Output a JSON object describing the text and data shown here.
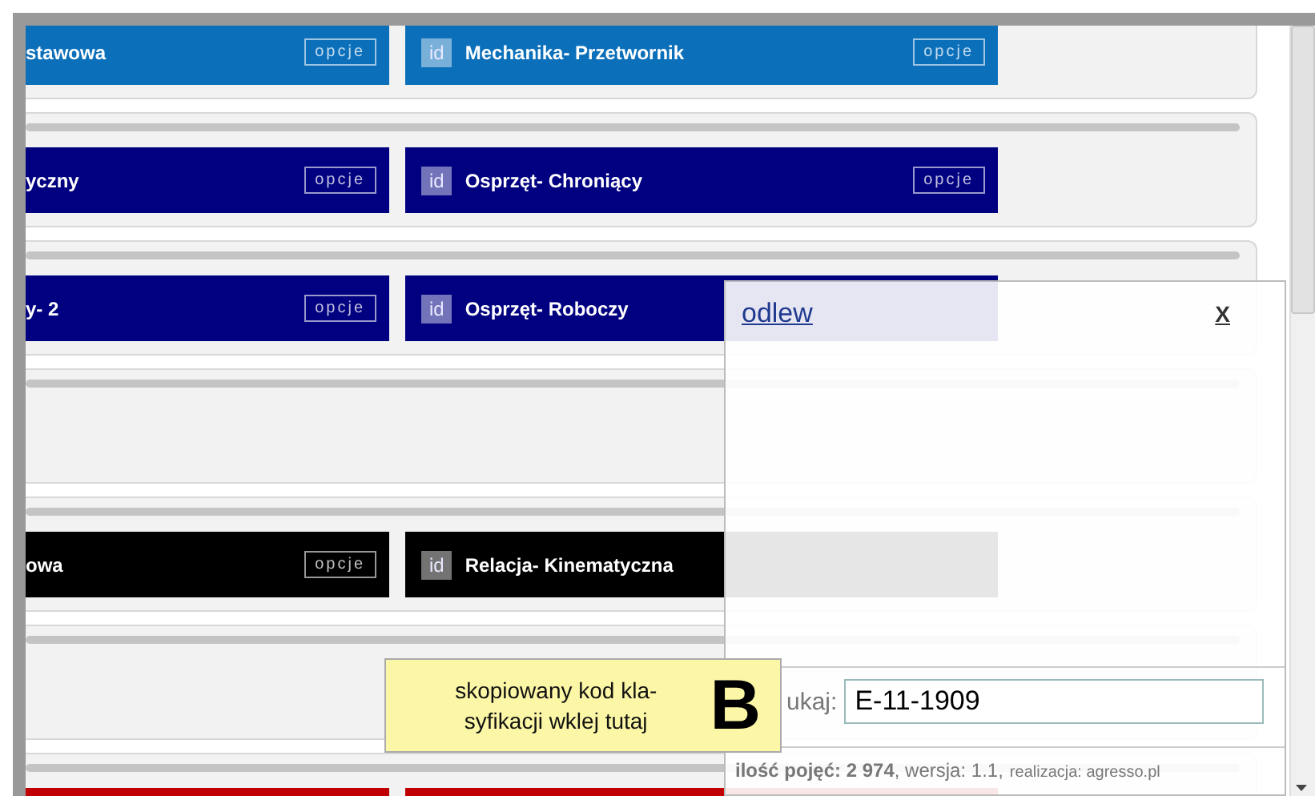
{
  "cards": [
    {
      "kind": "tiles",
      "color": "#0b6fba",
      "tiles": [
        {
          "label": "stawowa",
          "button": "opcje"
        },
        {
          "id_tag": "id",
          "label": "Mechanika- Przetwornik",
          "button": "opcje"
        }
      ]
    },
    {
      "kind": "tiles",
      "color": "#000080",
      "tiles": [
        {
          "label": "yczny",
          "button": "opcje"
        },
        {
          "id_tag": "id",
          "label": "Osprzęt- Chroniący",
          "button": "opcje"
        }
      ]
    },
    {
      "kind": "tiles",
      "color": "#000080",
      "tiles": [
        {
          "label": "y- 2",
          "button": "opcje"
        },
        {
          "id_tag": "id",
          "label": "Osprzęt- Roboczy"
        }
      ]
    },
    {
      "kind": "empty"
    },
    {
      "kind": "tiles",
      "color": "#000000",
      "tiles": [
        {
          "label": "owa",
          "button": "opcje"
        },
        {
          "id_tag": "id",
          "label": "Relacja- Kinematyczna"
        }
      ]
    },
    {
      "kind": "empty"
    },
    {
      "kind": "cut",
      "color": "#c00000"
    }
  ],
  "popup": {
    "link": "odlew",
    "close": "X",
    "search": {
      "label": "ukaj:",
      "value": "E-11-1909"
    },
    "stats": "**ilość pojęć: 2 974**, wersja: 1.1,",
    "credit": "realizacja: agresso.pl"
  },
  "tooltip": {
    "lines": [
      "skopiowany kod kla-",
      "syfikacji wklej tutaj"
    ],
    "letter": "B"
  }
}
